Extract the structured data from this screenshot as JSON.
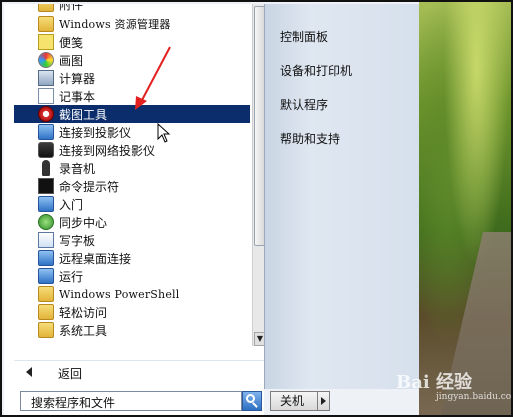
{
  "start_menu": {
    "programs": [
      {
        "label": "附件",
        "icon": "folder-icon",
        "top_px_hidden": true
      },
      {
        "label": "Windows 资源管理器",
        "icon": "explorer-icon"
      },
      {
        "label": "便笺",
        "icon": "sticky-notes-icon"
      },
      {
        "label": "画图",
        "icon": "paint-icon"
      },
      {
        "label": "计算器",
        "icon": "calculator-icon"
      },
      {
        "label": "记事本",
        "icon": "notepad-icon"
      },
      {
        "label": "截图工具",
        "icon": "snipping-tool-icon",
        "highlighted": true
      },
      {
        "label": "连接到投影仪",
        "icon": "projector-icon"
      },
      {
        "label": "连接到网络投影仪",
        "icon": "network-projector-icon"
      },
      {
        "label": "录音机",
        "icon": "microphone-icon"
      },
      {
        "label": "命令提示符",
        "icon": "command-prompt-icon"
      },
      {
        "label": "入门",
        "icon": "getting-started-icon"
      },
      {
        "label": "同步中心",
        "icon": "sync-center-icon"
      },
      {
        "label": "写字板",
        "icon": "wordpad-icon"
      },
      {
        "label": "远程桌面连接",
        "icon": "remote-desktop-icon"
      },
      {
        "label": "运行",
        "icon": "run-icon"
      },
      {
        "label": "Windows PowerShell",
        "icon": "folder-icon"
      },
      {
        "label": "轻松访问",
        "icon": "folder-icon"
      },
      {
        "label": "系统工具",
        "icon": "folder-icon"
      }
    ],
    "back_label": "返回",
    "search_placeholder": "搜索程序和文件",
    "right_items": [
      "控制面板",
      "设备和打印机",
      "默认程序",
      "帮助和支持"
    ],
    "shutdown_label": "关机"
  },
  "watermark": {
    "text": "Bai 经验",
    "sub": "jingyan.baidu.com"
  },
  "colors": {
    "highlight": "#0b2d6b",
    "annotation_arrow": "#e32020"
  }
}
